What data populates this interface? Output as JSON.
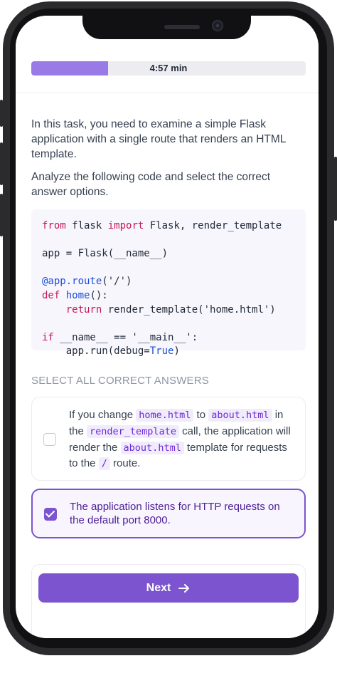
{
  "header": {
    "timer": "4:57 min",
    "progress": 0.28
  },
  "task": {
    "intro": "In this task, you need to examine a simple Flask application with a single route that renders an HTML template.",
    "prompt": "Analyze the following code and select the correct answer options."
  },
  "code": {
    "l1_kw": "from",
    "l1_a": " flask ",
    "l1_kw2": "import",
    "l1_b": " Flask, render_template",
    "l3": "app = Flask(__name__)",
    "l5_dec": "@app.route",
    "l5_b": "('/')",
    "l6_kw": "def",
    "l6_fn": " home",
    "l6_b": "():",
    "l7_kw": "return",
    "l7_b": " render_template('home.html')",
    "l9_kw": "if",
    "l9_b": " __name__ == '__main__':",
    "l10_a": "app.run(debug=",
    "l10_const": "True",
    "l10_b": ")"
  },
  "section_label": "SELECT ALL CORRECT ANSWERS",
  "options": [
    {
      "t1": "If you change ",
      "c1": "home.html",
      "t2": " to ",
      "c2": "about.html",
      "t3": " in the ",
      "c3": "render_template",
      "t4": " call, the application will render the ",
      "c4": "about.html",
      "t5": " template for requests to the ",
      "c5": "/",
      "t6": " route.",
      "checked": false
    },
    {
      "text": "The application listens for HTTP requests on the default port 8000.",
      "checked": true
    }
  ],
  "next_button": {
    "label": "Next"
  },
  "colors": {
    "accent": "#7c54cf",
    "progress": "#9a7ae6"
  }
}
